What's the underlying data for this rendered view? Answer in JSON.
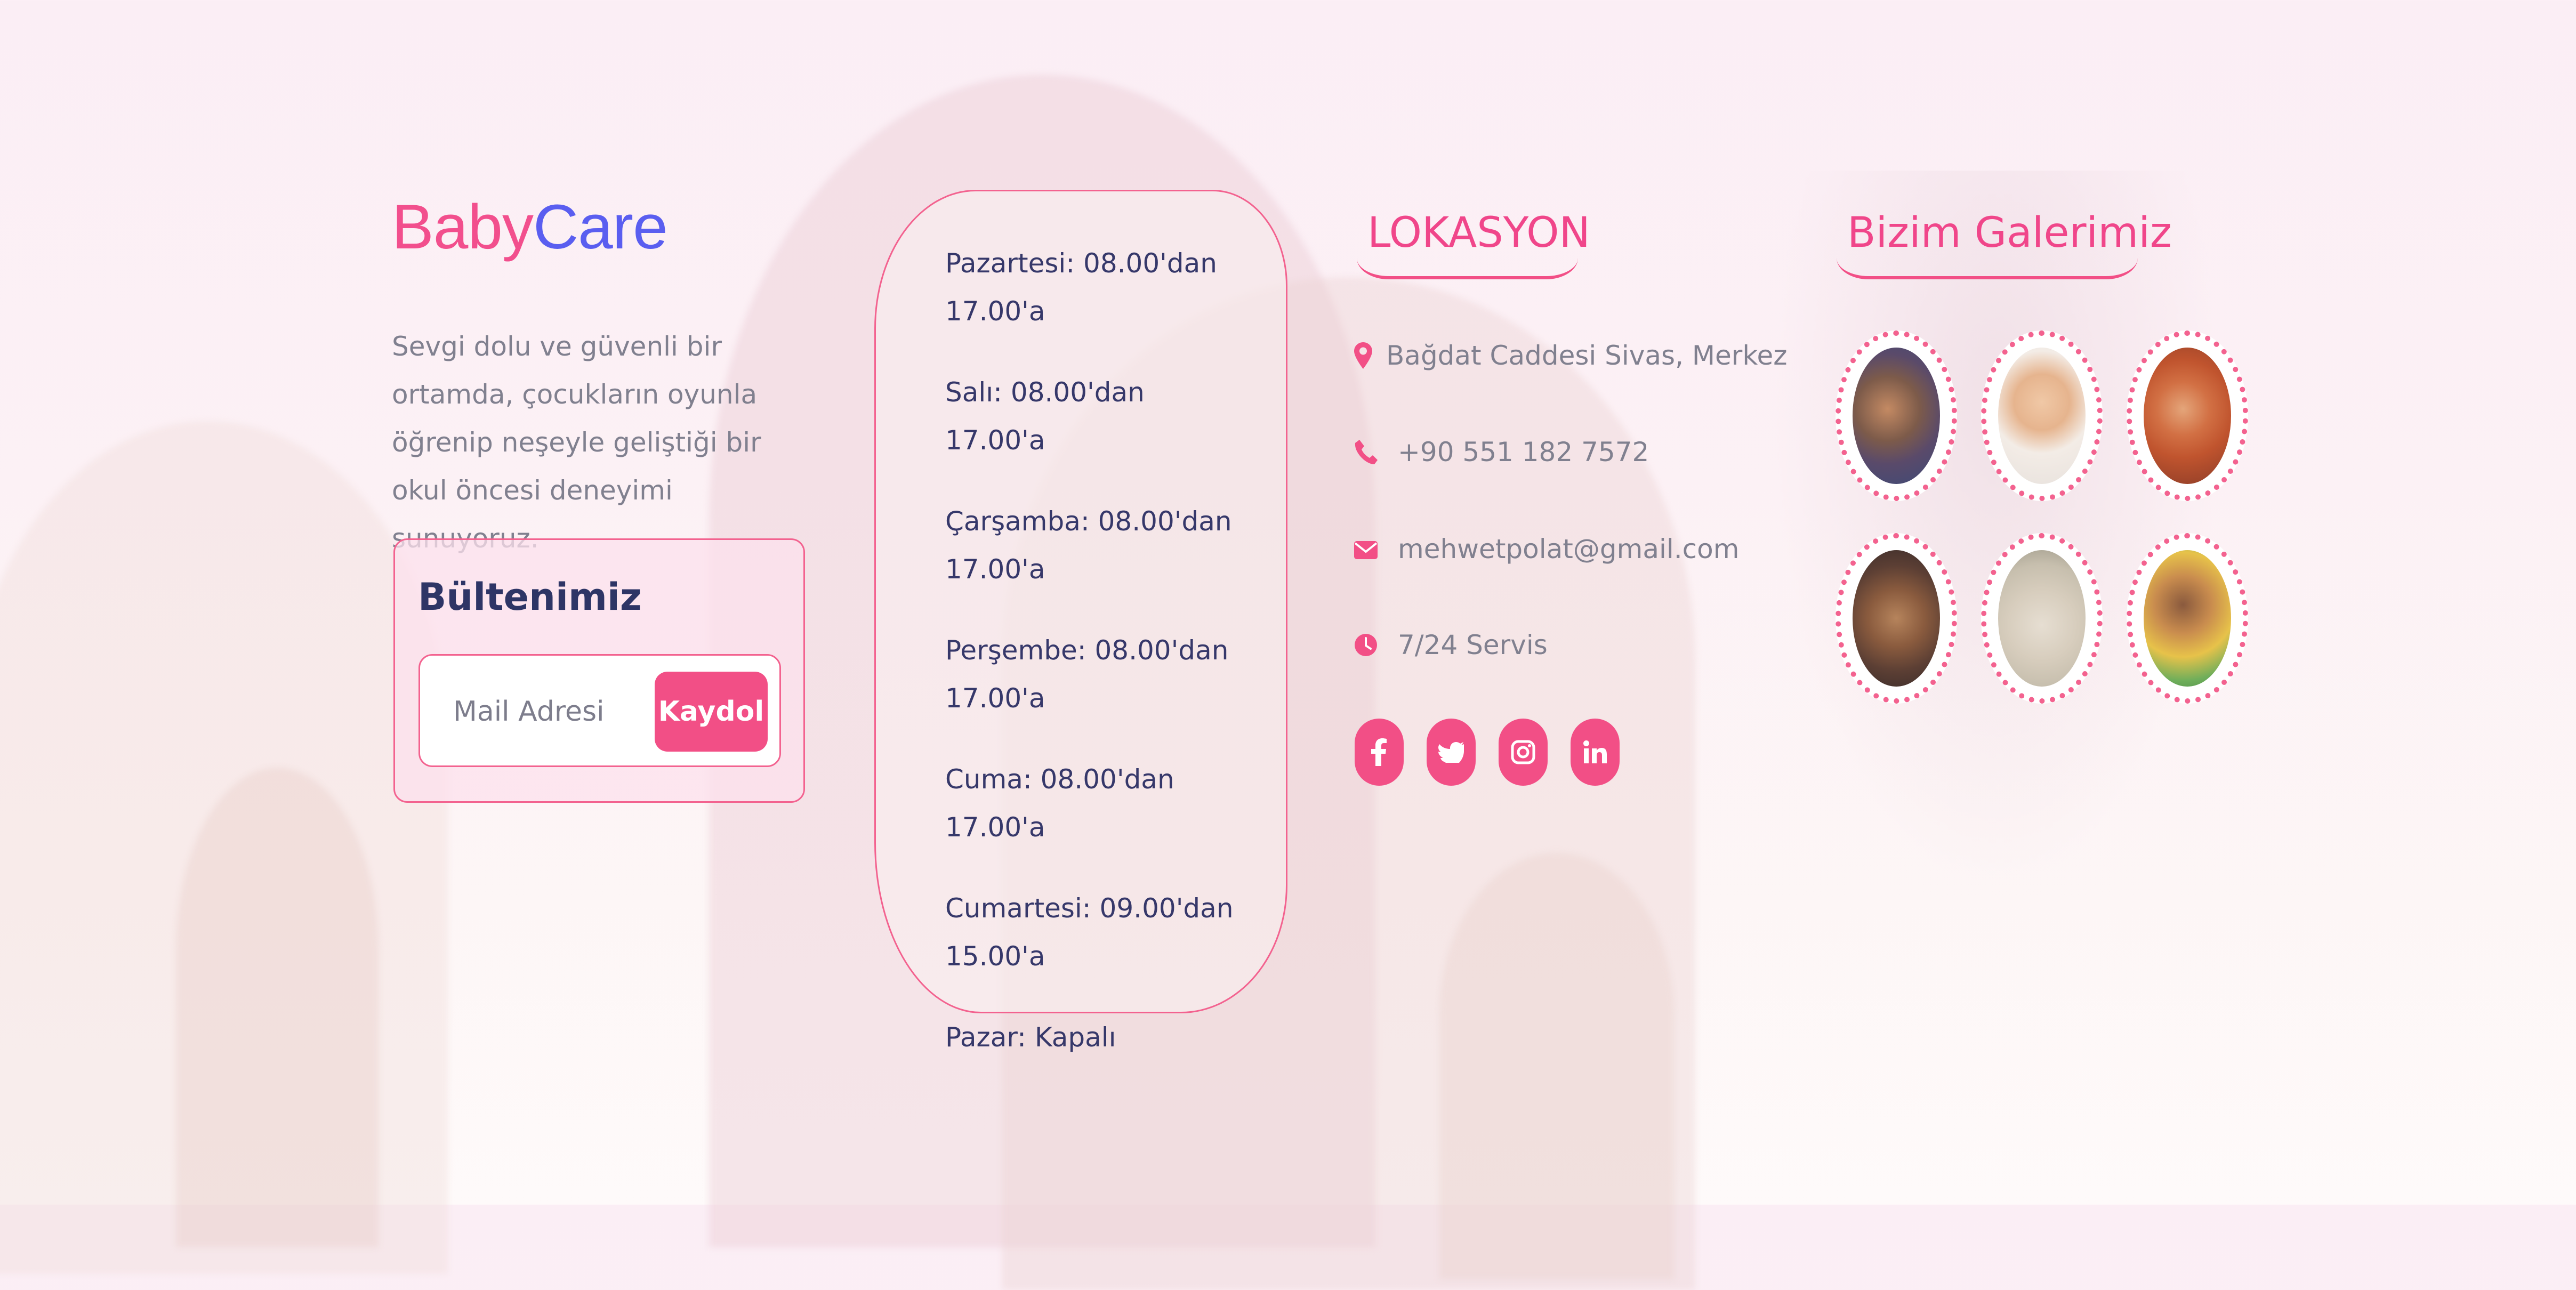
{
  "brand": {
    "part1": "Baby",
    "part2": "Care"
  },
  "about": {
    "text": "Sevgi dolu ve güvenli bir ortamda, çocukların oyunla öğrenip neşeyle geliştiği bir okul öncesi deneyimi sunuyoruz."
  },
  "newsletter": {
    "title": "Bültenimiz",
    "placeholder": "Mail Adresi",
    "button": "Kaydol"
  },
  "hours": [
    "Pazartesi: 08.00'dan 17.00'a",
    "Salı: 08.00'dan 17.00'a",
    "Çarşamba: 08.00'dan 17.00'a",
    "Perşembe: 08.00'dan 17.00'a",
    "Cuma: 08.00'dan 17.00'a",
    "Cumartesi: 09.00'dan 15.00'a",
    "Pazar: Kapalı"
  ],
  "location": {
    "title": "LOKASYON",
    "address": "Bağdat Caddesi Sivas, Merkez",
    "phone": "+90 551 182 7572",
    "email": "mehwetpolat@gmail.com",
    "service": "7/24 Servis",
    "icons": [
      "map-pin-icon",
      "phone-icon",
      "envelope-icon",
      "clock-icon"
    ]
  },
  "socials": [
    {
      "name": "facebook-icon",
      "glyph": "f"
    },
    {
      "name": "twitter-icon",
      "glyph": ""
    },
    {
      "name": "instagram-icon",
      "glyph": ""
    },
    {
      "name": "linkedin-icon",
      "glyph": "in"
    }
  ],
  "gallery": {
    "title": "Bizim Galerimiz",
    "photos": [
      {
        "name": "gallery-photo-classroom-group"
      },
      {
        "name": "gallery-photo-child-drawing"
      },
      {
        "name": "gallery-photo-child-painting"
      },
      {
        "name": "gallery-photo-child-blocks"
      },
      {
        "name": "gallery-photo-children-playing-floor"
      },
      {
        "name": "gallery-photo-toddler-toys"
      }
    ]
  },
  "colors": {
    "accent": "#f24f86",
    "brand_pink": "#f24f8d",
    "brand_blue": "#5a5ef0",
    "heading_dark": "#2e3566",
    "text_muted": "#80808f"
  }
}
